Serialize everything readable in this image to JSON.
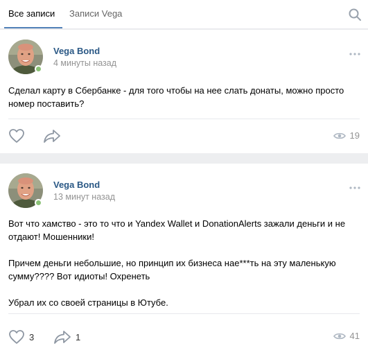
{
  "tabs": {
    "all_posts": "Все записи",
    "owner_posts": "Записи Vega"
  },
  "icons": {
    "search": "search-icon",
    "more": "more-icon",
    "like": "heart-icon",
    "share": "share-arrow-icon",
    "views": "eye-icon"
  },
  "colors": {
    "link": "#2a5885",
    "accent": "#5181b8",
    "online": "#8ac176",
    "muted": "#939393",
    "background": "#edeef0"
  },
  "posts": [
    {
      "author": "Vega Bond",
      "time": "4 минуты назад",
      "paragraphs": [
        "Сделал карту в Сбербанке - для того чтобы на нее слать донаты, можно просто номер поставить?"
      ],
      "likes": "",
      "shares": "",
      "views": "19"
    },
    {
      "author": "Vega Bond",
      "time": "13 минут назад",
      "paragraphs": [
        "Вот что хамство - это то что и Yandex Wallet и DonationAlerts зажали деньги и не отдают! Мошенники!",
        "Причем деньги небольшие, но принцип их бизнеса нае***ть на эту маленькую сумму???? Вот идиоты! Охренеть",
        "Убрал их со своей страницы в Ютубе."
      ],
      "likes": "3",
      "shares": "1",
      "views": "41"
    }
  ]
}
